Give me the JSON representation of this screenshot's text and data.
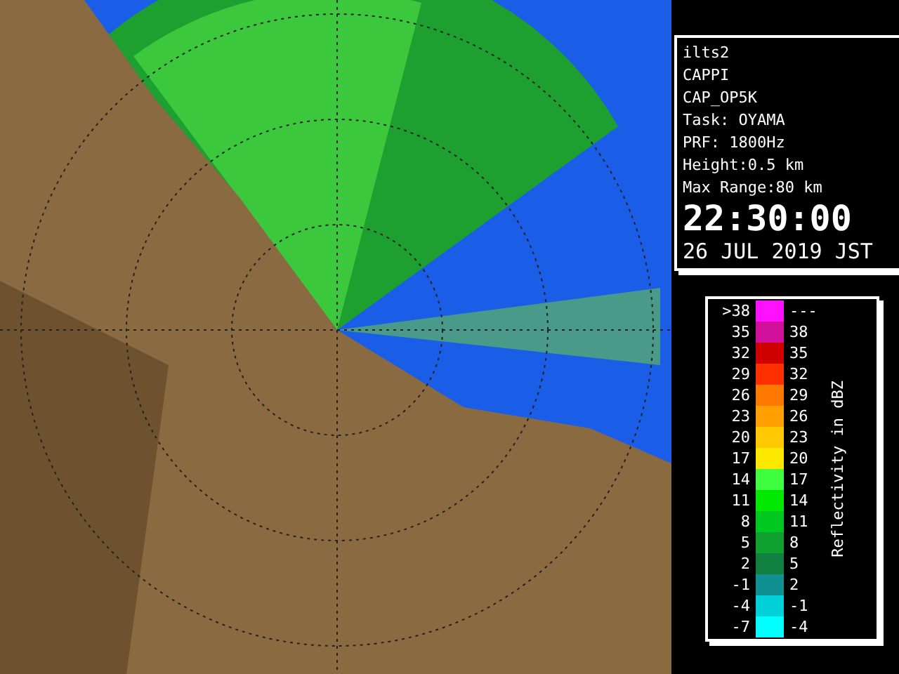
{
  "info_panel": {
    "lines": [
      "ilts2",
      "CAPPI",
      "CAP_OP5K",
      "Task: OYAMA",
      "PRF: 1800Hz",
      "Height:0.5 km",
      "Max Range:80 km"
    ],
    "time": "22:30:00",
    "date": "26 JUL 2019 JST"
  },
  "legend": {
    "title": "Reflectivity in dBZ",
    "rows": [
      {
        "low": ">38",
        "high": "---",
        "color": "#ff10ff"
      },
      {
        "low": "35",
        "high": "38",
        "color": "#d0109a"
      },
      {
        "low": "32",
        "high": "35",
        "color": "#d00000"
      },
      {
        "low": "29",
        "high": "32",
        "color": "#ff3000"
      },
      {
        "low": "26",
        "high": "29",
        "color": "#ff7800"
      },
      {
        "low": "23",
        "high": "26",
        "color": "#ffa000"
      },
      {
        "low": "20",
        "high": "23",
        "color": "#ffc800"
      },
      {
        "low": "17",
        "high": "20",
        "color": "#ffe800"
      },
      {
        "low": "14",
        "high": "17",
        "color": "#40ff40"
      },
      {
        "low": "11",
        "high": "14",
        "color": "#00e800"
      },
      {
        "low": "8",
        "high": "11",
        "color": "#00c820"
      },
      {
        "low": "5",
        "high": "8",
        "color": "#10a030"
      },
      {
        "low": "2",
        "high": "5",
        "color": "#108040"
      },
      {
        "low": "-1",
        "high": "2",
        "color": "#109090"
      },
      {
        "low": "-4",
        "high": "-1",
        "color": "#00d0d8"
      },
      {
        "low": "-7",
        "high": "-4",
        "color": "#00ffff"
      }
    ]
  }
}
